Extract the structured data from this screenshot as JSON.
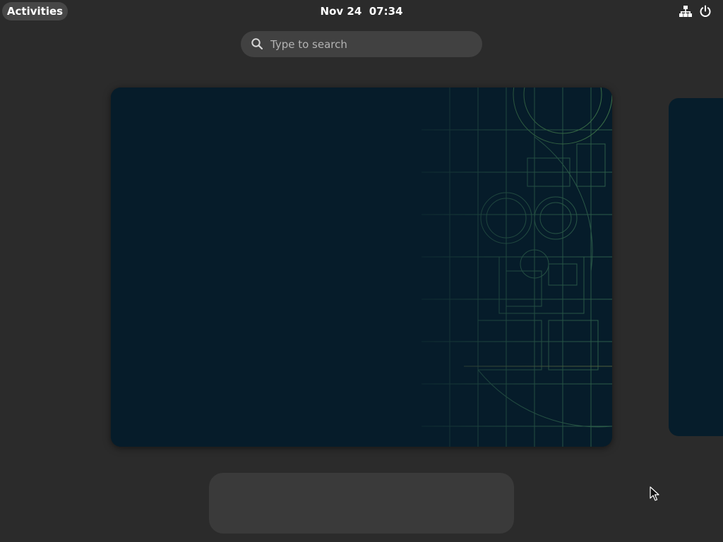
{
  "topbar": {
    "activities_label": "Activities",
    "clock": "Nov 24  07:34",
    "icons": [
      "network-icon",
      "power-icon"
    ]
  },
  "search": {
    "placeholder": "Type to search",
    "value": ""
  },
  "colors": {
    "background": "#2b2b2b",
    "panel_button": "#474747",
    "search_bg": "#414141",
    "wallpaper": "#061c2a",
    "blueprint_lines": "#3f7a55",
    "dash_bg": "#3a3a3a"
  }
}
